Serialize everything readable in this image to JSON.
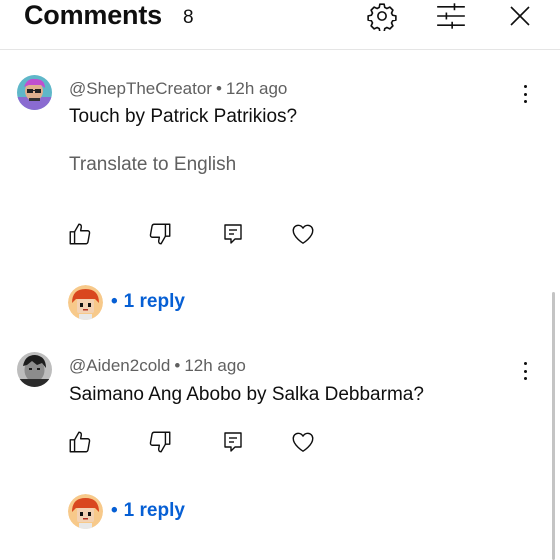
{
  "header": {
    "title": "Comments",
    "count": "8",
    "icons": [
      "gear-icon",
      "filter-sliders-icon",
      "close-icon"
    ]
  },
  "comments": [
    {
      "author": "@ShepTheCreator",
      "separator": "•",
      "time": "12h ago",
      "text": "Touch by Patrick Patrikios?",
      "translate": "Translate to English",
      "replies": {
        "dot": "•",
        "label": "1 reply"
      }
    },
    {
      "author": "@Aiden2cold",
      "separator": "•",
      "time": "12h ago",
      "text": "Saimano Ang Abobo by Salka Debbarma?",
      "replies": {
        "dot": "•",
        "label": "1 reply"
      }
    }
  ],
  "colors": {
    "link": "#065fd4",
    "secondary_text": "#606060",
    "primary_text": "#0f0f0f"
  }
}
